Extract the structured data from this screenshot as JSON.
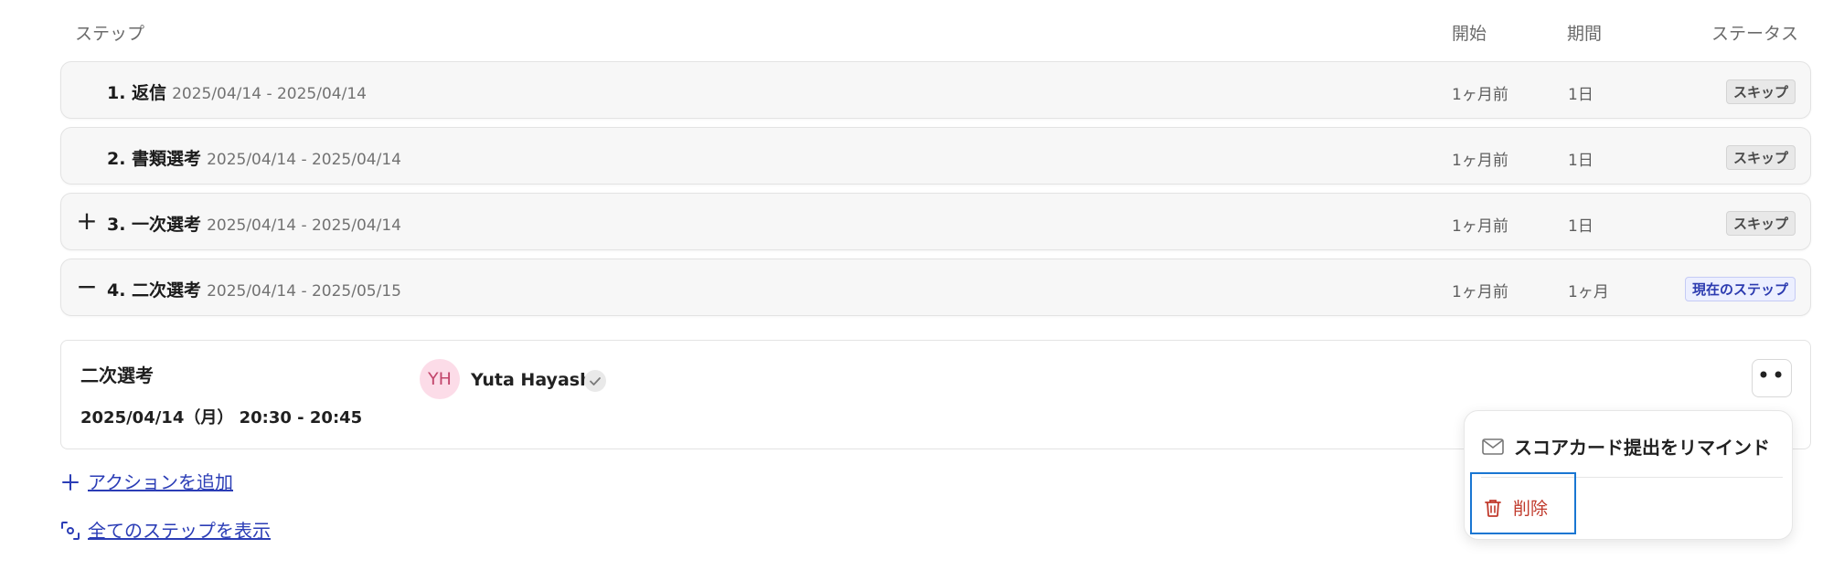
{
  "table_header": {
    "step": "ステップ",
    "start": "開始",
    "duration": "期間",
    "status": "ステータス"
  },
  "steps": [
    {
      "title": "1. 返信",
      "date_range": "2025/04/14 - 2025/04/14",
      "start": "1ヶ月前",
      "duration": "1日",
      "status": "スキップ",
      "toggle": ""
    },
    {
      "title": "2. 書類選考",
      "date_range": "2025/04/14 - 2025/04/14",
      "start": "1ヶ月前",
      "duration": "1日",
      "status": "スキップ",
      "toggle": ""
    },
    {
      "title": "3. 一次選考",
      "date_range": "2025/04/14 - 2025/04/14",
      "start": "1ヶ月前",
      "duration": "1日",
      "status": "スキップ",
      "toggle": "+"
    },
    {
      "title": "4. 二次選考",
      "date_range": "2025/04/14 - 2025/05/15",
      "start": "1ヶ月前",
      "duration": "1ヶ月",
      "status": "現在のステップ",
      "toggle": "−"
    }
  ],
  "detail": {
    "title": "二次選考",
    "datetime": "2025/04/14（月） 20:30 - 20:45",
    "avatar_initials": "YH",
    "user_name": "Yuta Hayashi",
    "more_label": "••"
  },
  "actions": {
    "add_action": "アクションを追加",
    "show_all_steps": "全てのステップを表示"
  },
  "menu": {
    "remind": "スコアカード提出をリマインド",
    "delete": "削除"
  },
  "colors": {
    "link": "#2b3db6",
    "danger": "#c0392b",
    "current_badge": "#2c3bb0",
    "focus_outline": "#1976d2"
  }
}
